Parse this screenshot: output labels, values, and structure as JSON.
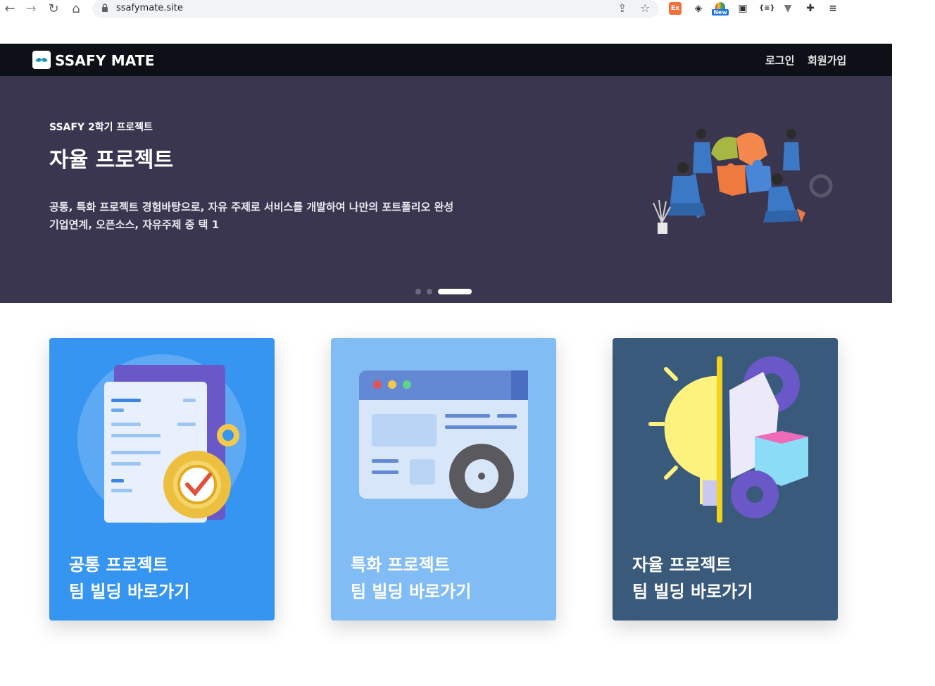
{
  "browser": {
    "url": "ssafymate.site",
    "extensions": {
      "ex_label": "Ex",
      "new_badge": "New"
    }
  },
  "header": {
    "logo_text": "SSAFY MATE",
    "login_label": "로그인",
    "signup_label": "회원가입"
  },
  "hero": {
    "subtitle": "SSAFY 2학기 프로젝트",
    "title": "자율 프로젝트",
    "desc_line1": "공통, 특화 프로젝트 경험바탕으로, 자유 주제로 서비스를 개발하여 나만의 포트폴리오 완성",
    "desc_line2": "기업연계, 오픈소스, 자유주제 중 택 1",
    "carousel_active_index": 3,
    "carousel_total": 3
  },
  "cards": [
    {
      "line1": "공통 프로젝트",
      "line2": "팀 빌딩 바로가기",
      "color": "#3595f0"
    },
    {
      "line1": "특화 프로젝트",
      "line2": "팀 빌딩 바로가기",
      "color": "#82bcf5"
    },
    {
      "line1": "자율 프로젝트",
      "line2": "팀 빌딩 바로가기",
      "color": "#3a5a7c"
    }
  ],
  "colors": {
    "header_bg": "#0d1117",
    "hero_bg": "#3a364f"
  }
}
